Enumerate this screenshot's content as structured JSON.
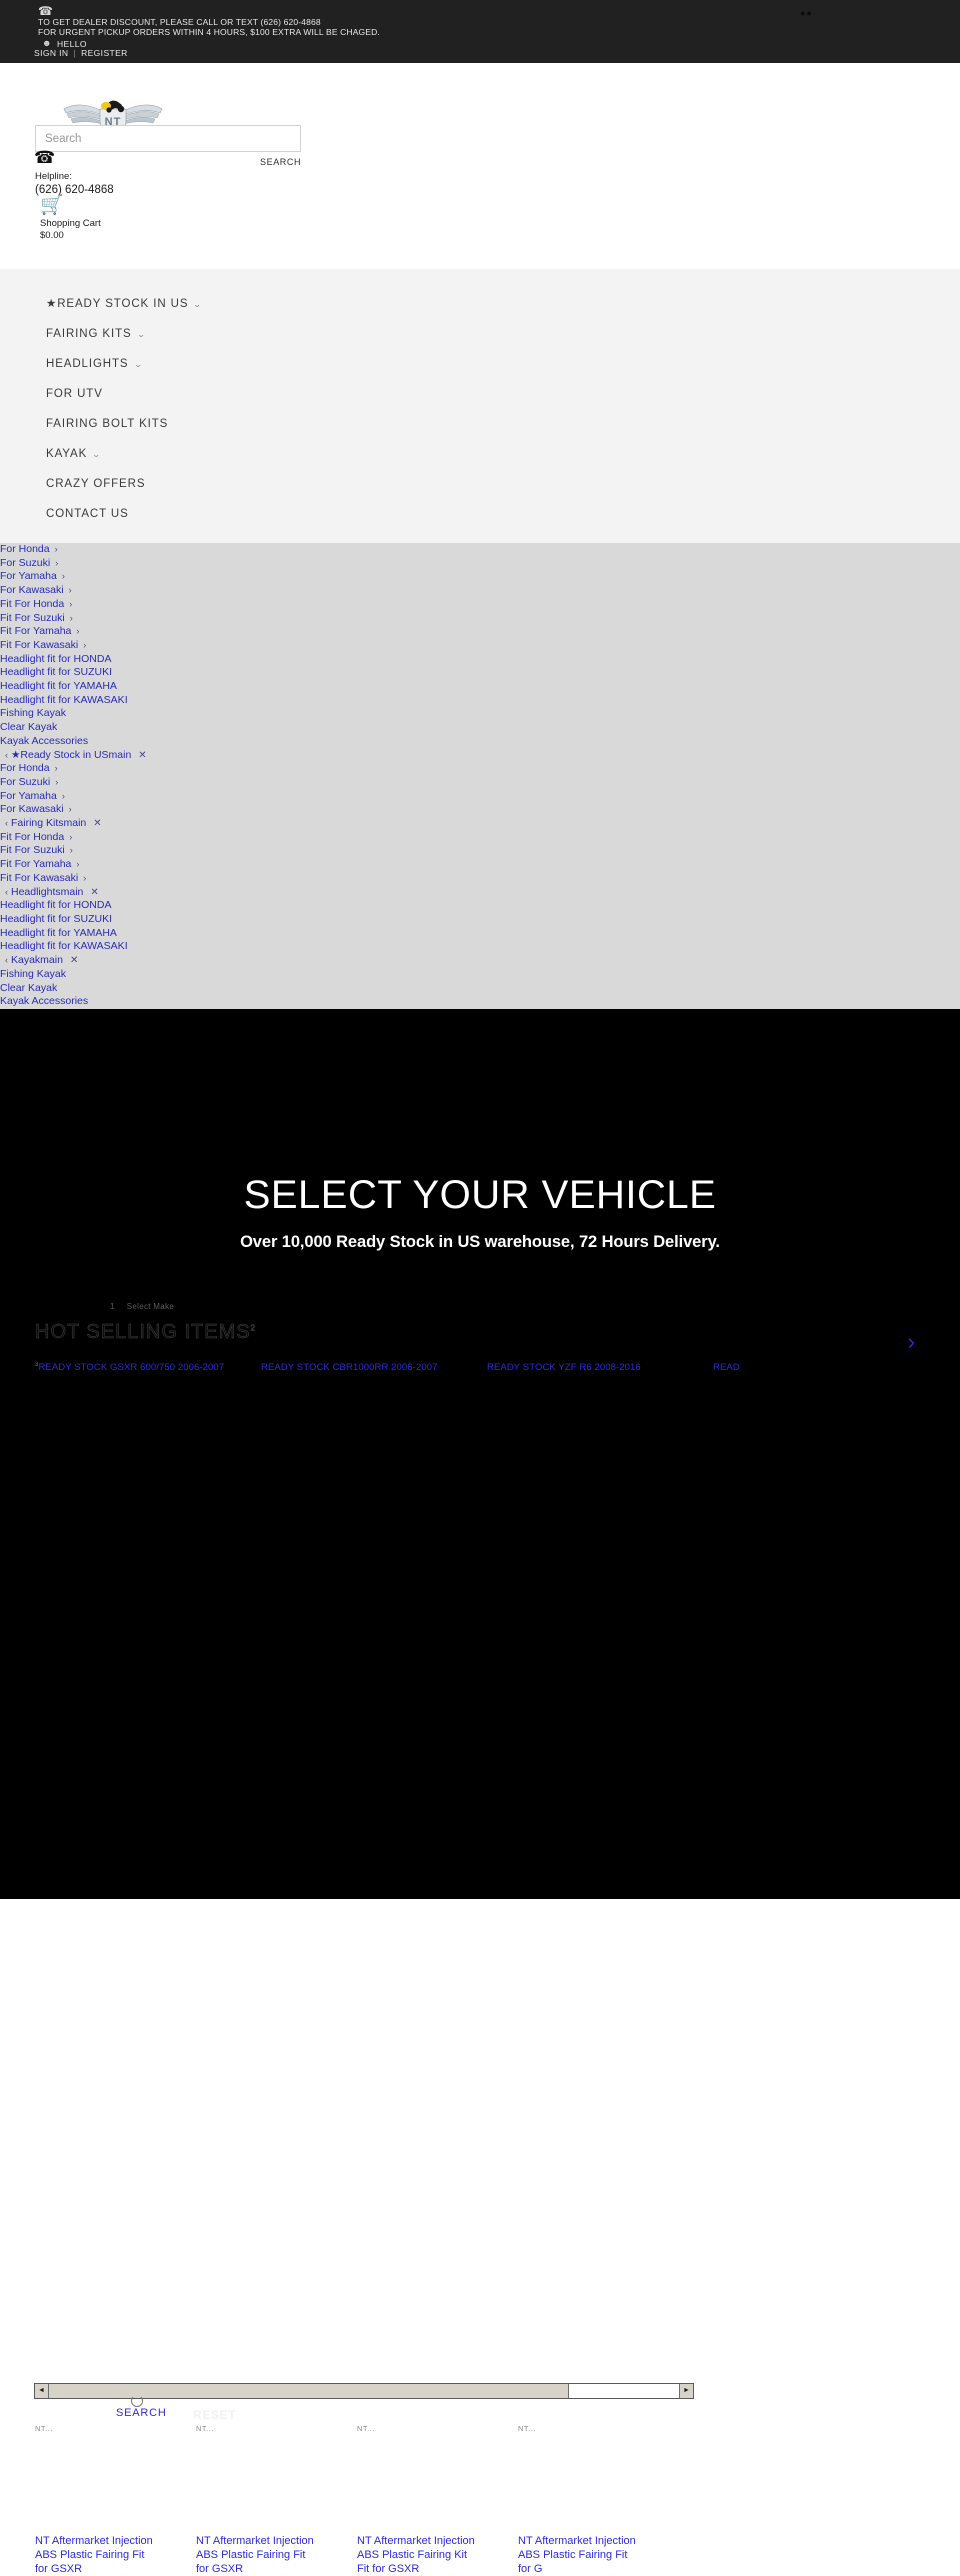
{
  "topbar": {
    "phone_icon": "phone-icon",
    "line1": "TO GET DEALER DISCOUNT, PLEASE CALL OR TEXT (626) 620-4868",
    "line2": "FOR URGENT PICKUP ORDERS WITHIN 4 HOURS, $100 EXTRA WILL BE CHAGED.",
    "user_icon": "user-icon",
    "hello": "HELLO",
    "sign_in": "SIGN IN",
    "separator": "|",
    "register": "REGISTER",
    "dots": "●●·"
  },
  "header": {
    "logo_text": "NT FAIRING",
    "logo_mark": "NT",
    "search_placeholder": "Search",
    "search_value": "",
    "search_button": "SEARCH",
    "helpline_label": "Helpline:",
    "helpline_number": "(626) 620-4868",
    "cart_label": "Shopping Cart",
    "cart_total": "$0.00"
  },
  "mainnav": {
    "items": [
      {
        "label": "★READY STOCK IN US",
        "caret": true
      },
      {
        "label": "FAIRING KITS",
        "caret": true
      },
      {
        "label": "HEADLIGHTS",
        "caret": true
      },
      {
        "label": "FOR UTV",
        "caret": false
      },
      {
        "label": "FAIRING BOLT KITS",
        "caret": false
      },
      {
        "label": "KAYAK",
        "caret": true
      },
      {
        "label": "CRAZY OFFERS",
        "caret": false
      },
      {
        "label": "CONTACT US",
        "caret": false
      }
    ]
  },
  "linklist": {
    "rows": [
      {
        "type": "link",
        "label": "For Honda",
        "arrow": "›"
      },
      {
        "type": "link",
        "label": "For Suzuki",
        "arrow": "›"
      },
      {
        "type": "link",
        "label": "For Yamaha",
        "arrow": "›"
      },
      {
        "type": "link",
        "label": "For Kawasaki",
        "arrow": "›"
      },
      {
        "type": "link",
        "label": "Fit For Honda",
        "arrow": "›"
      },
      {
        "type": "link",
        "label": "Fit For Suzuki",
        "arrow": "›"
      },
      {
        "type": "link",
        "label": "Fit For Yamaha",
        "arrow": "›"
      },
      {
        "type": "link",
        "label": "Fit For Kawasaki",
        "arrow": "›"
      },
      {
        "type": "link",
        "label": "Headlight fit for HONDA",
        "arrow": ""
      },
      {
        "type": "link",
        "label": "Headlight fit for SUZUKI",
        "arrow": ""
      },
      {
        "type": "link",
        "label": "Headlight fit for YAMAHA",
        "arrow": ""
      },
      {
        "type": "link",
        "label": "Headlight fit for KAWASAKI",
        "arrow": ""
      },
      {
        "type": "link",
        "label": "Fishing Kayak",
        "arrow": ""
      },
      {
        "type": "link",
        "label": "Clear Kayak",
        "arrow": ""
      },
      {
        "type": "link",
        "label": "Kayak Accessories",
        "arrow": ""
      },
      {
        "type": "header",
        "label": "★Ready Stock in USmain",
        "back": "‹",
        "close": "✕"
      },
      {
        "type": "link",
        "label": "For Honda",
        "arrow": "›"
      },
      {
        "type": "link",
        "label": "For Suzuki",
        "arrow": "›"
      },
      {
        "type": "link",
        "label": "For Yamaha",
        "arrow": "›"
      },
      {
        "type": "link",
        "label": "For Kawasaki",
        "arrow": "›"
      },
      {
        "type": "header",
        "label": "Fairing Kitsmain",
        "back": "‹",
        "close": "✕"
      },
      {
        "type": "link",
        "label": "Fit For Honda",
        "arrow": "›"
      },
      {
        "type": "link",
        "label": "Fit For Suzuki",
        "arrow": "›"
      },
      {
        "type": "link",
        "label": "Fit For Yamaha",
        "arrow": "›"
      },
      {
        "type": "link",
        "label": "Fit For Kawasaki",
        "arrow": "›"
      },
      {
        "type": "header",
        "label": "Headlightsmain",
        "back": "‹",
        "close": "✕"
      },
      {
        "type": "link",
        "label": "Headlight fit for HONDA",
        "arrow": ""
      },
      {
        "type": "link",
        "label": "Headlight fit for SUZUKI",
        "arrow": ""
      },
      {
        "type": "link",
        "label": "Headlight fit for YAMAHA",
        "arrow": ""
      },
      {
        "type": "link",
        "label": "Headlight fit for KAWASAKI",
        "arrow": ""
      },
      {
        "type": "header",
        "label": "Kayakmain",
        "back": "‹",
        "close": "✕"
      },
      {
        "type": "link",
        "label": "Fishing Kayak",
        "arrow": ""
      },
      {
        "type": "link",
        "label": "Clear Kayak",
        "arrow": ""
      },
      {
        "type": "link",
        "label": "Kayak Accessories",
        "arrow": ""
      }
    ]
  },
  "hero": {
    "title": "SELECT YOUR VEHICLE",
    "subtitle": "Over 10,000 Ready Stock in US warehouse, 72 Hours Delivery.",
    "step_number": "1",
    "select_make": "Select Make",
    "hot_heading": "HOT SELLING ITEMS",
    "hot_heading_sup": "2",
    "next_arrow": "›",
    "search_button": "SEARCH",
    "reset_button": "RESET",
    "scroll_left": "◄",
    "scroll_right": "►",
    "product_links": [
      {
        "label": "READY STOCK GSXR 600/750 2006-2007",
        "sup": "3"
      },
      {
        "label": "READY STOCK CBR1000RR 2006-2007",
        "sup": ""
      },
      {
        "label": "READY STOCK YZF R6 2008-2016",
        "sup": ""
      },
      {
        "label": "READ",
        "sup": ""
      }
    ],
    "cards": [
      {
        "image_alt": "NT...",
        "title": "NT Aftermarket Injection ABS Plastic Fairing Fit for GSXR"
      },
      {
        "image_alt": "NT...",
        "title": "NT Aftermarket Injection ABS Plastic Fairing Fit for GSXR"
      },
      {
        "image_alt": "NT...",
        "title": "NT Aftermarket Injection ABS Plastic Fairing Kit Fit for GSXR"
      },
      {
        "image_alt": "NT...",
        "title": "NT Aftermarket Injection ABS Plastic Fairing Fit for G"
      }
    ]
  },
  "colors": {
    "topbar_bg": "#212121",
    "nav_bg": "#f3f3f3",
    "linklist_bg": "#d9d9d9",
    "link_blue": "#2b2bbb",
    "hero_bg": "#000000",
    "accent_blue": "#2b2bdd"
  }
}
